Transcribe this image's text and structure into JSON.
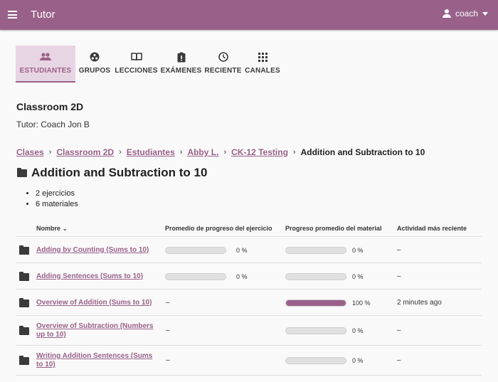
{
  "app": {
    "title": "Tutor",
    "user": "coach"
  },
  "tabs": [
    {
      "label": "ESTUDIANTES",
      "icon": "people-icon",
      "active": true
    },
    {
      "label": "GRUPOS",
      "icon": "groups-icon",
      "active": false
    },
    {
      "label": "LECCIONES",
      "icon": "book-icon",
      "active": false
    },
    {
      "label": "EXÁMENES",
      "icon": "exam-icon",
      "active": false
    },
    {
      "label": "RECIENTE",
      "icon": "clock-icon",
      "active": false
    },
    {
      "label": "CANALES",
      "icon": "apps-icon",
      "active": false
    }
  ],
  "classroom": {
    "name": "Classroom 2D",
    "tutor": "Tutor: Coach Jon B"
  },
  "breadcrumb": {
    "items": [
      "Clases",
      "Classroom 2D",
      "Estudiantes",
      "Abby L.",
      "CK-12 Testing"
    ],
    "current": "Addition and Subtraction to 10",
    "separator": "›"
  },
  "topic": {
    "title": "Addition and Subtraction to 10",
    "summary": [
      "2 ejercicios",
      "6 materiales"
    ]
  },
  "table": {
    "headers": {
      "name": "Nombre",
      "exercise_progress": "Promedio de progreso del ejercicio",
      "material_progress": "Progreso promedio del material",
      "recent": "Actividad más reciente"
    },
    "rows": [
      {
        "name": "Adding by Counting (Sums to 10)",
        "exercise": {
          "value": 0,
          "label": "0 %"
        },
        "material": {
          "value": 0,
          "label": "0 %"
        },
        "recent": "–"
      },
      {
        "name": "Adding Sentences (Sums to 10)",
        "exercise": {
          "value": 0,
          "label": "0 %"
        },
        "material": {
          "value": 0,
          "label": "0 %"
        },
        "recent": "–"
      },
      {
        "name": "Overview of Addition (Sums to 10)",
        "exercise": null,
        "material": {
          "value": 100,
          "label": "100 %"
        },
        "recent": "2 minutes ago"
      },
      {
        "name": "Overview of Subtraction (Numbers up to 10)",
        "exercise": null,
        "material": {
          "value": 0,
          "label": "0 %"
        },
        "recent": "–"
      },
      {
        "name": "Writing Addition Sentences (Sums to 10)",
        "exercise": null,
        "material": {
          "value": 0,
          "label": "0 %"
        },
        "recent": "–"
      }
    ],
    "empty_mark": "–"
  },
  "colors": {
    "brand": "#996189",
    "active_tab_bg": "#e8d5e3"
  }
}
